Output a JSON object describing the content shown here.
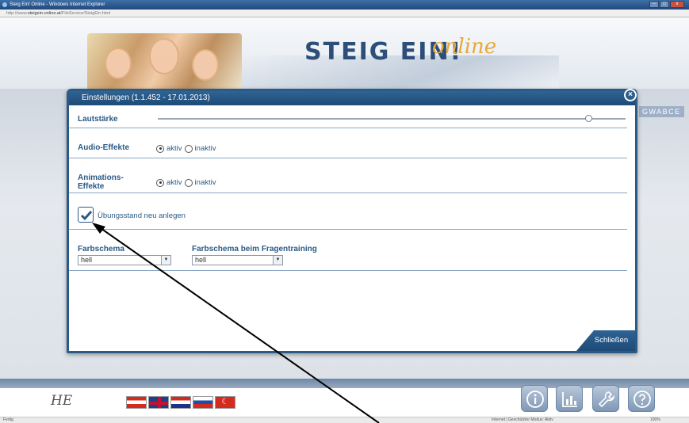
{
  "browser": {
    "title": "Steig Ein! Online - Windows Internet Explorer",
    "url_prefix": "http://www.",
    "url_host": "steigein-online.at",
    "url_path": "/FileService/SteigEin.html",
    "status_left": "Fertig",
    "status_zone": "Internet | Geschützter Modus: Aktiv",
    "status_zoom": "100%"
  },
  "header": {
    "logo": "STEIG EIN!",
    "logo_online": "online",
    "side_text": "GWABCE"
  },
  "dialog": {
    "title": "Einstellungen (1.1.452 - 17.01.2013)",
    "volume_label": "Lautstärke",
    "volume_level": 0.92,
    "audio_label": "Audio-Effekte",
    "audio_selected": "aktiv",
    "animation_label": "Animations-Effekte",
    "animation_selected": "aktiv",
    "option_active": "aktiv",
    "option_inactive": "inaktiv",
    "checkbox_label": "Übungsstand neu anlegen",
    "checkbox_checked": true,
    "color_scheme_label": "Farbschema",
    "color_scheme_value": "hell",
    "color_scheme_training_label": "Farbschema beim Fragentraining",
    "color_scheme_training_value": "hell",
    "close_label": "Schließen"
  },
  "footer": {
    "logo": "HE",
    "flags": [
      "austria-flag",
      "uk-flag",
      "croatia-flag",
      "slovenia-flag",
      "turkey-flag"
    ],
    "tools": [
      "info-icon",
      "statistics-icon",
      "wrench-icon",
      "help-icon"
    ]
  }
}
